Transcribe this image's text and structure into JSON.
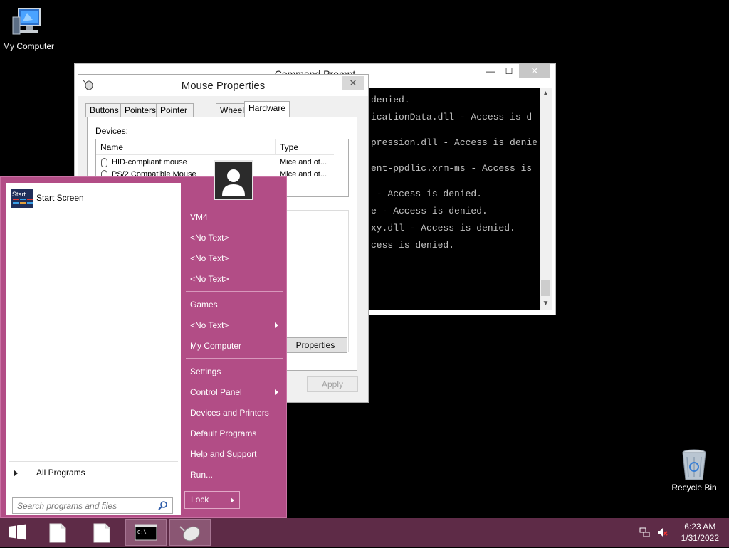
{
  "desktop": {
    "icons": [
      {
        "label": "My Computer"
      },
      {
        "label": "Recycle Bin"
      }
    ]
  },
  "cmd_window": {
    "title": "Command Prompt",
    "lines": [
      "denied.",
      "icationData.dll - Access is d",
      "pression.dll - Access is denie",
      "ent-ppdlic.xrm-ms - Access is",
      " - Access is denied.",
      "e - Access is denied.",
      "xy.dll - Access is denied.",
      "cess is denied."
    ],
    "minimize": "—",
    "maximize": "☐",
    "close": "✕"
  },
  "mouse_dialog": {
    "title": "Mouse Properties",
    "tabs": [
      "Buttons",
      "Pointers",
      "Pointer Options",
      "Wheel",
      "Hardware"
    ],
    "active_tab": "Hardware",
    "devices_label": "Devices:",
    "columns": [
      "Name",
      "Type"
    ],
    "devices": [
      {
        "name": "HID-compliant mouse",
        "type": "Mice and ot..."
      },
      {
        "name": "PS/2 Compatible Mouse",
        "type": "Mice and ot..."
      }
    ],
    "properties_button": "Properties",
    "apply_button": "Apply",
    "close": "✕"
  },
  "start_menu": {
    "pinned": [
      {
        "label": "Start Screen",
        "tile_text": "Start"
      }
    ],
    "all_programs": "All Programs",
    "search_placeholder": "Search programs and files",
    "right_items": [
      {
        "label": "VM4",
        "submenu": false
      },
      {
        "label": "<No Text>",
        "submenu": false
      },
      {
        "label": "<No Text>",
        "submenu": false
      },
      {
        "label": "<No Text>",
        "submenu": false
      },
      {
        "label": "Games",
        "submenu": false
      },
      {
        "label": "<No Text>",
        "submenu": true
      },
      {
        "label": "My Computer",
        "submenu": false
      },
      {
        "label": "Settings",
        "submenu": false
      },
      {
        "label": "Control Panel",
        "submenu": true
      },
      {
        "label": "Devices and Printers",
        "submenu": false
      },
      {
        "label": "Default Programs",
        "submenu": false
      },
      {
        "label": "Help and Support",
        "submenu": false
      },
      {
        "label": "Run...",
        "submenu": false
      }
    ],
    "lock_label": "Lock"
  },
  "taskbar": {
    "time": "6:23 AM",
    "date": "1/31/2022",
    "buttons": [
      "start-button",
      "notepad",
      "notepad",
      "command-prompt",
      "mouse-properties"
    ]
  },
  "colors": {
    "start_menu_bg": "#b24d86",
    "taskbar_bg": "#5e2b47",
    "console_bg": "#000000",
    "console_fg": "#c0c0c0"
  }
}
